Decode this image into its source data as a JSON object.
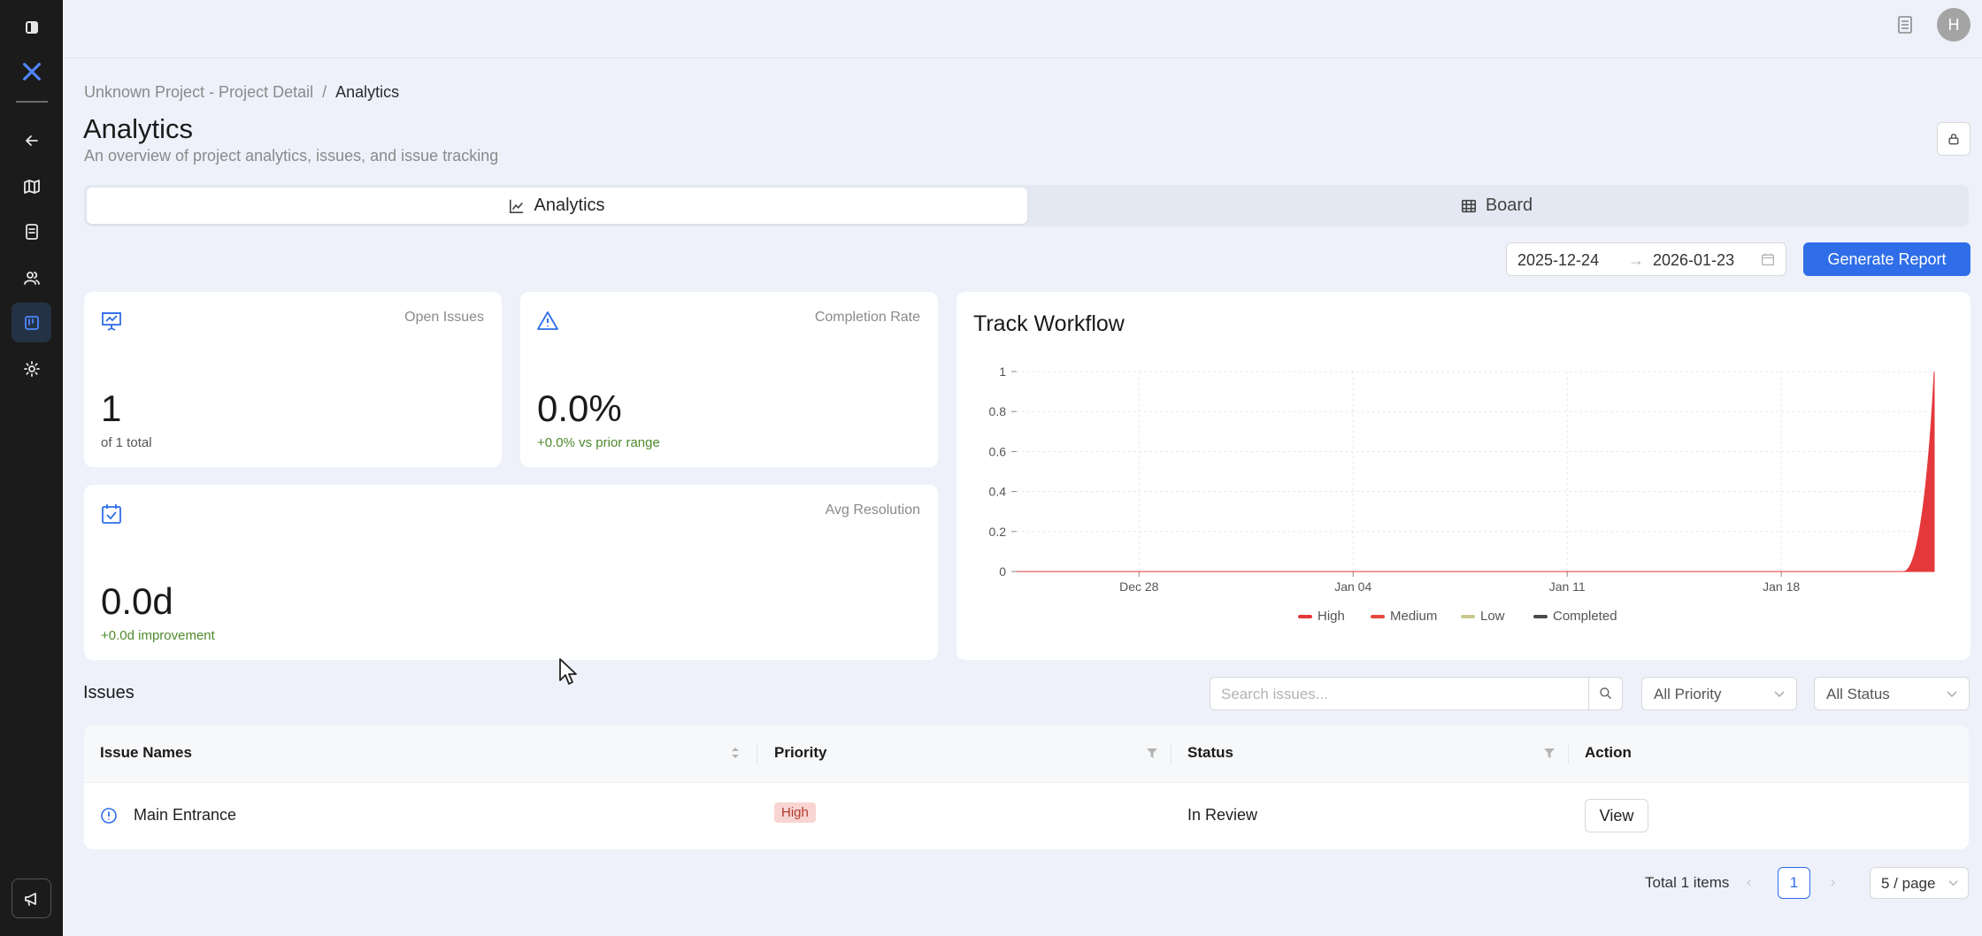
{
  "header": {
    "avatar_initial": "H"
  },
  "breadcrumb": {
    "parent": "Unknown Project - Project Detail",
    "separator": "/",
    "current": "Analytics"
  },
  "page": {
    "title": "Analytics",
    "subtitle": "An overview of project analytics, issues, and issue tracking"
  },
  "tabs": [
    {
      "label": "Analytics",
      "icon": "line-chart-icon",
      "active": true
    },
    {
      "label": "Board",
      "icon": "table-icon",
      "active": false
    }
  ],
  "date_range": {
    "start": "2025-12-24",
    "arrow": "→",
    "end": "2026-01-23"
  },
  "generate_report_label": "Generate Report",
  "stats": {
    "open_issues": {
      "label": "Open Issues",
      "value": "1",
      "note": "of 1 total",
      "icon": "presentation-chart-icon"
    },
    "completion_rate": {
      "label": "Completion Rate",
      "value": "0.0%",
      "note": "+0.0% vs prior range",
      "icon": "warning-triangle-icon"
    },
    "avg_resolution": {
      "label": "Avg Resolution",
      "value": "0.0d",
      "note": "+0.0d improvement",
      "icon": "calendar-check-icon"
    }
  },
  "chart_data": {
    "type": "area",
    "title": "Track Workflow",
    "x": [
      "2025-12-24",
      "2025-12-25",
      "2025-12-26",
      "2025-12-27",
      "2025-12-28",
      "2025-12-29",
      "2025-12-30",
      "2025-12-31",
      "2026-01-01",
      "2026-01-02",
      "2026-01-03",
      "2026-01-04",
      "2026-01-05",
      "2026-01-06",
      "2026-01-07",
      "2026-01-08",
      "2026-01-09",
      "2026-01-10",
      "2026-01-11",
      "2026-01-12",
      "2026-01-13",
      "2026-01-14",
      "2026-01-15",
      "2026-01-16",
      "2026-01-17",
      "2026-01-18",
      "2026-01-19",
      "2026-01-20",
      "2026-01-21",
      "2026-01-22",
      "2026-01-23"
    ],
    "x_ticks": [
      "Dec 28",
      "Jan 04",
      "Jan 11",
      "Jan 18"
    ],
    "x_tick_dates": [
      "2025-12-28",
      "2026-01-04",
      "2026-01-11",
      "2026-01-18"
    ],
    "y_ticks": [
      "0",
      "0.2",
      "0.4",
      "0.6",
      "0.8",
      "1"
    ],
    "ylim": [
      0,
      1
    ],
    "grid": true,
    "legend_position": "bottom",
    "series": [
      {
        "name": "High",
        "color": "#e5383b",
        "values": [
          0,
          0,
          0,
          0,
          0,
          0,
          0,
          0,
          0,
          0,
          0,
          0,
          0,
          0,
          0,
          0,
          0,
          0,
          0,
          0,
          0,
          0,
          0,
          0,
          0,
          0,
          0,
          0,
          0,
          0,
          1
        ]
      },
      {
        "name": "Medium",
        "color": "#e5483b",
        "values": [
          0,
          0,
          0,
          0,
          0,
          0,
          0,
          0,
          0,
          0,
          0,
          0,
          0,
          0,
          0,
          0,
          0,
          0,
          0,
          0,
          0,
          0,
          0,
          0,
          0,
          0,
          0,
          0,
          0,
          0,
          0
        ]
      },
      {
        "name": "Low",
        "color": "#c9c78f",
        "values": [
          0,
          0,
          0,
          0,
          0,
          0,
          0,
          0,
          0,
          0,
          0,
          0,
          0,
          0,
          0,
          0,
          0,
          0,
          0,
          0,
          0,
          0,
          0,
          0,
          0,
          0,
          0,
          0,
          0,
          0,
          0
        ]
      },
      {
        "name": "Completed",
        "color": "#4a4a4a",
        "values": [
          0,
          0,
          0,
          0,
          0,
          0,
          0,
          0,
          0,
          0,
          0,
          0,
          0,
          0,
          0,
          0,
          0,
          0,
          0,
          0,
          0,
          0,
          0,
          0,
          0,
          0,
          0,
          0,
          0,
          0,
          0
        ]
      }
    ]
  },
  "issues": {
    "title": "Issues",
    "search_placeholder": "Search issues...",
    "priority_filter": "All Priority",
    "status_filter": "All Status",
    "columns": [
      "Issue Names",
      "Priority",
      "Status",
      "Action"
    ],
    "rows": [
      {
        "name": "Main Entrance",
        "priority": "High",
        "status": "In Review",
        "action": "View"
      }
    ]
  },
  "pagination": {
    "total": "Total 1 items",
    "prev": "‹",
    "page": "1",
    "next": "›",
    "page_size": "5 / page"
  },
  "colors": {
    "accent": "#2f6ee8",
    "sidebar_bg": "#1b1b1b",
    "page_bg": "#eef1fa",
    "positive": "#4e8a2c"
  }
}
